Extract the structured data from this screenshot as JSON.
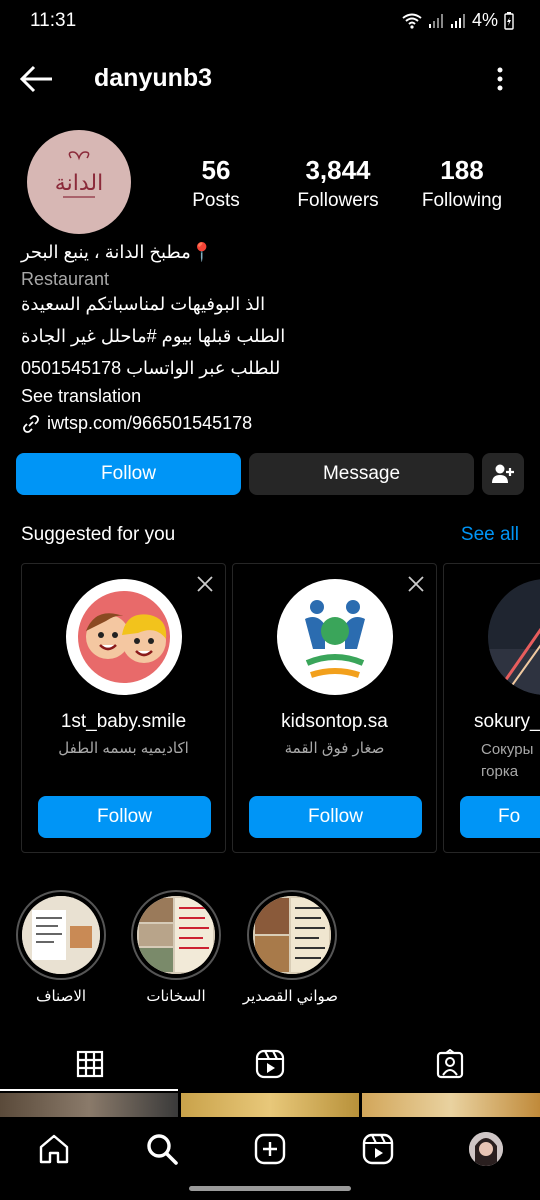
{
  "status_bar": {
    "time": "11:31",
    "battery": "4%"
  },
  "header": {
    "username": "danyunb3"
  },
  "profile": {
    "avatar_text": "الدانة",
    "stats": [
      {
        "value": "56",
        "label": "Posts"
      },
      {
        "value": "3,844",
        "label": "Followers"
      },
      {
        "value": "188",
        "label": "Following"
      }
    ],
    "bio": {
      "name_line": "📍مطبخ الدانة ، ينبع البحر",
      "category": "Restaurant",
      "line1": "الذ البوفيهات لمناسباتكم السعيدة",
      "line2": "الطلب قبلها بيوم #ماحلل غير الجادة",
      "line3": "للطلب عبر الواتساب 0501545178",
      "see_translation": "See translation",
      "link": "iwtsp.com/966501545178"
    }
  },
  "actions": {
    "follow": "Follow",
    "message": "Message"
  },
  "suggestions": {
    "title": "Suggested for you",
    "see_all": "See all",
    "cards": [
      {
        "name": "1st_baby.smile",
        "subtitle": "اكاديميه بسمه الطفل",
        "button": "Follow"
      },
      {
        "name": "kidsontop.sa",
        "subtitle": "صغار فوق القمة",
        "button": "Follow"
      },
      {
        "name": "sokury_",
        "subtitle": "Сокуры горка",
        "button": "Fo"
      }
    ]
  },
  "highlights": [
    {
      "label": "الاصناف"
    },
    {
      "label": "السخانات"
    },
    {
      "label": "صواني القصدير"
    }
  ],
  "colors": {
    "accent": "#0095f6",
    "secondary_button": "#262626",
    "muted_text": "#a8a8a8"
  }
}
